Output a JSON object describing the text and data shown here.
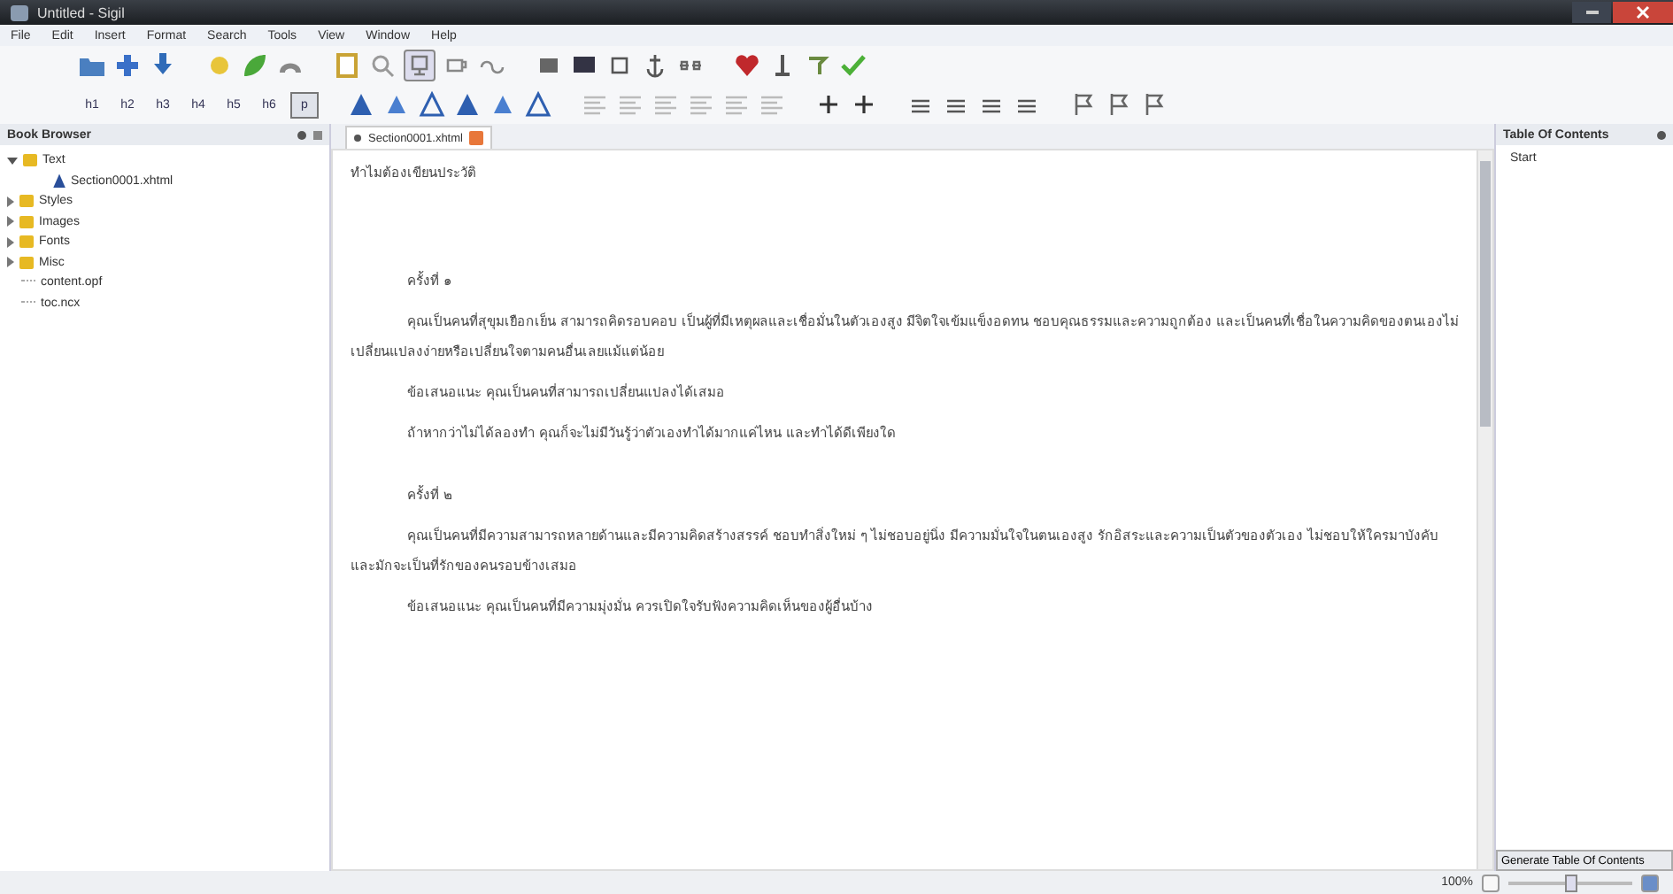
{
  "window": {
    "title": "Untitled - Sigil"
  },
  "menu": [
    "File",
    "Edit",
    "Insert",
    "Format",
    "Search",
    "Tools",
    "View",
    "Window",
    "Help"
  ],
  "heading_buttons": [
    {
      "label": "h1",
      "selected": false
    },
    {
      "label": "h2",
      "selected": false
    },
    {
      "label": "h3",
      "selected": false
    },
    {
      "label": "h4",
      "selected": false
    },
    {
      "label": "h5",
      "selected": false
    },
    {
      "label": "h6",
      "selected": false
    },
    {
      "label": "p",
      "selected": true
    }
  ],
  "book_browser": {
    "title": "Book Browser",
    "items": [
      {
        "label": "Text",
        "kind": "folder",
        "expanded": true,
        "children": [
          {
            "label": "Section0001.xhtml",
            "kind": "page"
          }
        ]
      },
      {
        "label": "Styles",
        "kind": "folder",
        "expanded": false
      },
      {
        "label": "Images",
        "kind": "folder",
        "expanded": false
      },
      {
        "label": "Fonts",
        "kind": "folder",
        "expanded": false
      },
      {
        "label": "Misc",
        "kind": "folder",
        "expanded": false
      },
      {
        "label": "content.opf",
        "kind": "file"
      },
      {
        "label": "toc.ncx",
        "kind": "file"
      }
    ]
  },
  "editor": {
    "tab": {
      "label": "Section0001.xhtml",
      "selected": true
    },
    "paragraphs": [
      {
        "kind": "title",
        "text": "ทำไมต้องเขียนประวัติ"
      },
      {
        "kind": "heading",
        "text": "ครั้งที่ ๑"
      },
      {
        "kind": "body",
        "text": "คุณเป็นคนที่สุขุมเยือกเย็น สามารถคิดรอบคอบ เป็นผู้ที่มีเหตุผลและเชื่อมั่นในตัวเองสูง มีจิตใจเข้มแข็งอดทน ชอบคุณธรรมและความถูกต้อง และเป็นคนที่เชื่อในความคิดของตนเองไม่เปลี่ยนแปลงง่ายหรือเปลี่ยนใจตามคนอื่นเลยแม้แต่น้อย"
      },
      {
        "kind": "body",
        "text": "ข้อเสนอแนะ คุณเป็นคนที่สามารถเปลี่ยนแปลงได้เสมอ"
      },
      {
        "kind": "body",
        "text": "ถ้าหากว่าไม่ได้ลองทำ คุณก็จะไม่มีวันรู้ว่าตัวเองทำได้มากแค่ไหน และทำได้ดีเพียงใด"
      },
      {
        "kind": "heading",
        "text": "ครั้งที่ ๒"
      },
      {
        "kind": "body",
        "text": "คุณเป็นคนที่มีความสามารถหลายด้านและมีความคิดสร้างสรรค์ ชอบทำสิ่งใหม่ ๆ ไม่ชอบอยู่นิ่ง มีความมั่นใจในตนเองสูง รักอิสระและความเป็นตัวของตัวเอง ไม่ชอบให้ใครมาบังคับ และมักจะเป็นที่รักของคนรอบข้างเสมอ"
      },
      {
        "kind": "body",
        "text": "ข้อเสนอแนะ คุณเป็นคนที่มีความมุ่งมั่น ควรเปิดใจรับฟังความคิดเห็นของผู้อื่นบ้าง"
      }
    ]
  },
  "toc": {
    "title": "Table Of Contents",
    "items": [
      "Start"
    ],
    "button": "Generate Table Of Contents"
  },
  "status_bar": {
    "zoom": "100%",
    "level": 0.5
  }
}
